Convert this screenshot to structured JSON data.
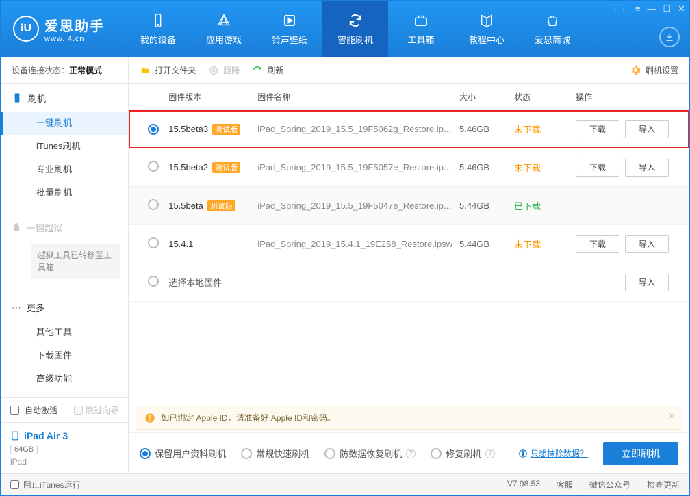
{
  "logo": {
    "main": "爱思助手",
    "sub": "www.i4.cn",
    "glyph": "iU"
  },
  "nav": [
    {
      "label": "我的设备"
    },
    {
      "label": "应用游戏"
    },
    {
      "label": "铃声壁纸"
    },
    {
      "label": "智能刷机"
    },
    {
      "label": "工具箱"
    },
    {
      "label": "教程中心"
    },
    {
      "label": "爱思商城"
    }
  ],
  "nav_active_index": 3,
  "sidebar": {
    "status_label": "设备连接状态：",
    "status_value": "正常模式",
    "group_flash": "刷机",
    "items_flash": [
      "一键刷机",
      "iTunes刷机",
      "专业刷机",
      "批量刷机"
    ],
    "flash_active_index": 0,
    "group_jailbreak": "一键越狱",
    "jailbreak_note": "越狱工具已转移至工具箱",
    "group_more": "更多",
    "items_more": [
      "其他工具",
      "下载固件",
      "高级功能"
    ],
    "auto_activate": "自动激活",
    "skip_guide": "跳过向导",
    "device_name": "iPad Air 3",
    "device_storage": "64GB",
    "device_type": "iPad"
  },
  "toolbar": {
    "open_folder": "打开文件夹",
    "delete": "删除",
    "refresh": "刷新",
    "settings": "刷机设置"
  },
  "columns": {
    "version": "固件版本",
    "name": "固件名称",
    "size": "大小",
    "status": "状态",
    "ops": "操作"
  },
  "beta_tag": "测试版",
  "firmware": [
    {
      "selected": true,
      "ver": "15.5beta3",
      "beta": true,
      "name": "iPad_Spring_2019_15.5_19F5062g_Restore.ip...",
      "size": "5.46GB",
      "status": "未下载",
      "status_cls": "st-orange",
      "dl": true,
      "imp": true,
      "highlight": true
    },
    {
      "selected": false,
      "ver": "15.5beta2",
      "beta": true,
      "name": "iPad_Spring_2019_15.5_19F5057e_Restore.ip...",
      "size": "5.46GB",
      "status": "未下载",
      "status_cls": "st-orange",
      "dl": true,
      "imp": true,
      "highlight": false
    },
    {
      "selected": false,
      "ver": "15.5beta",
      "beta": true,
      "name": "iPad_Spring_2019_15.5_19F5047e_Restore.ip...",
      "size": "5.44GB",
      "status": "已下载",
      "status_cls": "st-green",
      "dl": false,
      "imp": false,
      "highlight": false,
      "alt": true
    },
    {
      "selected": false,
      "ver": "15.4.1",
      "beta": false,
      "name": "iPad_Spring_2019_15.4.1_19E258_Restore.ipsw",
      "size": "5.44GB",
      "status": "未下载",
      "status_cls": "st-orange",
      "dl": true,
      "imp": true,
      "highlight": false
    },
    {
      "selected": false,
      "ver": "选择本地固件",
      "beta": false,
      "name": "",
      "size": "",
      "status": "",
      "status_cls": "",
      "dl": false,
      "imp": true,
      "highlight": false,
      "local": true
    }
  ],
  "buttons": {
    "download": "下载",
    "import": "导入"
  },
  "tip": "如已绑定 Apple ID，请准备好 Apple ID和密码。",
  "flash_opts": [
    {
      "label": "保留用户资料刷机",
      "checked": true,
      "help": false
    },
    {
      "label": "常规快速刷机",
      "checked": false,
      "help": false
    },
    {
      "label": "防数据恢复刷机",
      "checked": false,
      "help": true
    },
    {
      "label": "修复刷机",
      "checked": false,
      "help": true
    }
  ],
  "erase_link": "只想抹除数据？",
  "flash_button": "立即刷机",
  "footer": {
    "block_itunes": "阻止iTunes运行",
    "version": "V7.98.53",
    "links": [
      "客服",
      "微信公众号",
      "检查更新"
    ]
  }
}
